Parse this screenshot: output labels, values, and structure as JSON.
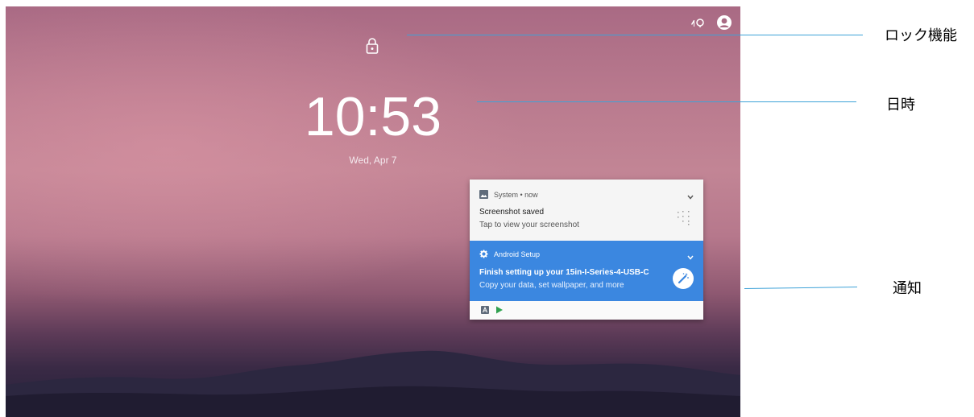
{
  "lock_screen": {
    "time": "10:53",
    "date": "Wed, Apr 7"
  },
  "notifications": {
    "system": {
      "header": "System • now",
      "title": "Screenshot saved",
      "text": "Tap to view your screenshot"
    },
    "setup": {
      "header": "Android Setup",
      "title": "Finish setting up your 15in-I-Series-4-USB-C",
      "text": "Copy your data, set wallpaper, and more"
    }
  },
  "callouts": {
    "lock": "ロック機能",
    "datetime": "日時",
    "notification": "通知"
  },
  "icons": {
    "status": [
      "signal-icon",
      "user-avatar-icon"
    ],
    "lock": "lock-icon",
    "system": "image-icon",
    "setup": "gear-icon",
    "action": "magic-wand-icon",
    "footer": [
      "app-a-icon",
      "play-store-icon"
    ]
  },
  "colors": {
    "setup_bg": "#3b87e0",
    "callout_line": "#3ea2d8"
  }
}
